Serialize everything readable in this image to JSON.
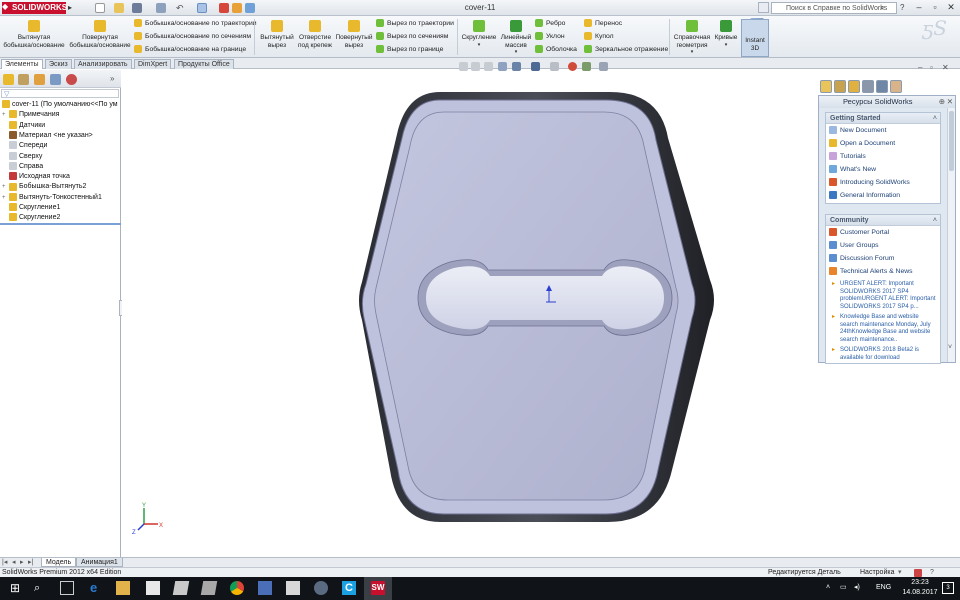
{
  "app": {
    "logo_text": "SOLIDWORKS",
    "document_title": "cover-11"
  },
  "help_search": {
    "placeholder": "Поиск в Справке по SolidWorks"
  },
  "window_controls": {
    "minimize": "–",
    "restore": "▫",
    "close": "✕"
  },
  "ribbon": {
    "big_buttons": [
      {
        "label": "Вытянутая бобышка/основание",
        "color": "#e8b92c"
      },
      {
        "label": "Повернутая бобышка/основание",
        "color": "#e8b92c"
      }
    ],
    "boss_rows": [
      {
        "label": "Бобышка/основание по траектории",
        "color": "#e8b92c"
      },
      {
        "label": "Бобышка/основание по сечениям",
        "color": "#e8b92c"
      },
      {
        "label": "Бобышка/основание на границе",
        "color": "#e8b92c"
      }
    ],
    "cut_big": [
      {
        "label": "Вытянутый вырез",
        "color": "#e8b92c"
      },
      {
        "label": "Отверстие под крепеж",
        "color": "#e8b92c"
      },
      {
        "label": "Повернутый вырез",
        "color": "#e8b92c"
      }
    ],
    "cut_rows": [
      {
        "label": "Вырез по траектории",
        "color": "#6fbf3a"
      },
      {
        "label": "Вырез по сечениям",
        "color": "#6fbf3a"
      },
      {
        "label": "Вырез по границе",
        "color": "#6fbf3a"
      }
    ],
    "fillet_big": [
      {
        "label": "Скругление",
        "color": "#6fbf3a"
      },
      {
        "label": "Линейный массив",
        "color": "#3a9a3a"
      }
    ],
    "features_col1": [
      {
        "label": "Ребро",
        "color": "#6fbf3a"
      },
      {
        "label": "Уклон",
        "color": "#6fbf3a"
      },
      {
        "label": "Оболочка",
        "color": "#6fbf3a"
      }
    ],
    "features_col2": [
      {
        "label": "Перенос",
        "color": "#e8b92c"
      },
      {
        "label": "Купол",
        "color": "#e8b92c"
      },
      {
        "label": "Зеркальное отражение",
        "color": "#6fbf3a"
      }
    ],
    "ref_big": [
      {
        "label": "Справочная геометрия",
        "color": "#6fbf3a"
      },
      {
        "label": "Кривые",
        "color": "#3a9a3a"
      }
    ],
    "instant3d": "Instant 3D"
  },
  "command_tabs": [
    "Элементы",
    "Эскиз",
    "Анализировать",
    "DimXpert",
    "Продукты Office"
  ],
  "feature_tree": [
    {
      "label": "cover-11  (По умолчанию<<По ум",
      "expander": "",
      "color": "#e8b92c"
    },
    {
      "label": "Примечания",
      "expander": "+",
      "color": "#e8b92c"
    },
    {
      "label": "Датчики",
      "expander": "",
      "color": "#e8b92c"
    },
    {
      "label": "Материал <не указан>",
      "expander": "",
      "color": "#8a5a2c"
    },
    {
      "label": "Спереди",
      "expander": "",
      "color": "#c9ced6"
    },
    {
      "label": "Сверху",
      "expander": "",
      "color": "#c9ced6"
    },
    {
      "label": "Справа",
      "expander": "",
      "color": "#c9ced6"
    },
    {
      "label": "Исходная точка",
      "expander": "",
      "color": "#c43a3a"
    },
    {
      "label": "Бобышка-Вытянуть2",
      "expander": "+",
      "color": "#e8b92c"
    },
    {
      "label": "Вытянуть-Тонкостенный1",
      "expander": "+",
      "color": "#e8b92c"
    },
    {
      "label": "Скругление1",
      "expander": "",
      "color": "#e8b92c"
    },
    {
      "label": "Скругление2",
      "expander": "",
      "color": "#e8b92c"
    }
  ],
  "bottom_tabs": [
    "Модель",
    "Анимация1"
  ],
  "status": {
    "version": "SolidWorks Premium 2012 x64 Edition",
    "editing": "Редактируется Деталь",
    "settings": "Настройка"
  },
  "triad": {
    "x": "X",
    "y": "Y",
    "z": "Z"
  },
  "task_pane": {
    "title": "Ресурсы SolidWorks",
    "getting_started": {
      "heading": "Getting Started",
      "links": [
        {
          "label": "New Document",
          "color": "#9bb8e0"
        },
        {
          "label": "Open a Document",
          "color": "#e8b92c"
        },
        {
          "label": "Tutorials",
          "color": "#c9a2d9"
        },
        {
          "label": "What's New",
          "color": "#6fa8dc"
        },
        {
          "label": "Introducing SolidWorks",
          "color": "#d9572b"
        },
        {
          "label": "General Information",
          "color": "#3a78c4"
        }
      ]
    },
    "community": {
      "heading": "Community",
      "links": [
        {
          "label": "Customer Portal",
          "color": "#d9572b"
        },
        {
          "label": "User Groups",
          "color": "#5b8ed1"
        },
        {
          "label": "Discussion Forum",
          "color": "#5b8ed1"
        },
        {
          "label": "Technical Alerts & News",
          "color": "#e8842c"
        }
      ],
      "news": [
        "URGENT ALERT: Important SOLIDWORKS 2017 SP4 problemURGENT ALERT: Important SOLIDWORKS 2017 SP4 p...",
        "Knowledge Base and website search maintenance Monday, July 24thKnowledge Base and website search maintenance..",
        "SOLIDWORKS 2018 Beta2 is available for download"
      ]
    }
  },
  "taskbar": {
    "lang": "ENG",
    "time": "23:23",
    "date": "14.08.2017",
    "notifications": "3"
  }
}
